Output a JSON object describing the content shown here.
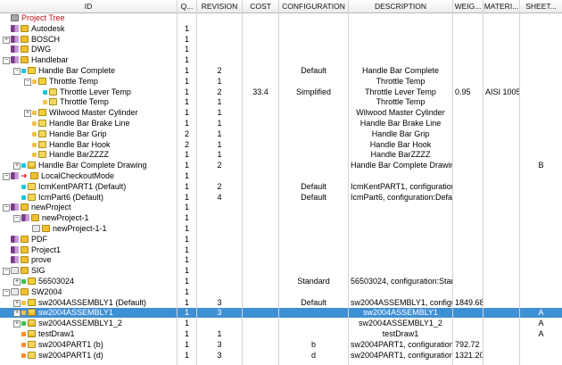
{
  "columns": {
    "id": "ID",
    "qty": "Q...",
    "revision": "REVISION",
    "cost": "COST",
    "configuration": "CONFIGURATION",
    "description": "DESCRIPTION",
    "weight": "WEIG...",
    "material": "MATERI...",
    "sheet": "SHEET..."
  },
  "colors": {
    "selection": "#3f8fd5",
    "root_text": "#c01010",
    "header_bg": "#ececec"
  },
  "rows": [
    {
      "label": "Project Tree",
      "depth": 0,
      "expander": "",
      "icons": [
        "root-icon"
      ],
      "qty": "",
      "revision": "",
      "cost": "",
      "configuration": "",
      "description": "",
      "weight": "",
      "material": "",
      "sheet": "",
      "root": true
    },
    {
      "label": "Autodesk",
      "depth": 0,
      "expander": "",
      "icons": [
        "stack-icon",
        "folder-icon"
      ],
      "qty": "1",
      "revision": "",
      "cost": "",
      "configuration": "",
      "description": "",
      "weight": "",
      "material": "",
      "sheet": ""
    },
    {
      "label": "BOSCH",
      "depth": 0,
      "expander": "+",
      "icons": [
        "stack-icon",
        "folder-icon"
      ],
      "qty": "1",
      "revision": "",
      "cost": "",
      "configuration": "",
      "description": "",
      "weight": "",
      "material": "",
      "sheet": ""
    },
    {
      "label": "DWG",
      "depth": 0,
      "expander": "",
      "icons": [
        "stack-icon",
        "folder-icon"
      ],
      "qty": "1",
      "revision": "",
      "cost": "",
      "configuration": "",
      "description": "",
      "weight": "",
      "material": "",
      "sheet": ""
    },
    {
      "label": "Handlebar",
      "depth": 0,
      "expander": "-",
      "icons": [
        "stack-icon",
        "folder-icon"
      ],
      "qty": "1",
      "revision": "",
      "cost": "",
      "configuration": "",
      "description": "",
      "weight": "",
      "material": "",
      "sheet": ""
    },
    {
      "label": "Handle Bar Complete",
      "depth": 1,
      "expander": "-",
      "icons": [
        "cyan-square-icon",
        "assembly-icon"
      ],
      "qty": "1",
      "revision": "2",
      "cost": "",
      "configuration": "Default",
      "description": "Handle Bar Complete",
      "weight": "",
      "material": "",
      "sheet": ""
    },
    {
      "label": "Throttle Temp",
      "depth": 2,
      "expander": "-",
      "icons": [
        "yellow-square-icon",
        "assembly-icon"
      ],
      "qty": "1",
      "revision": "1",
      "cost": "",
      "configuration": "",
      "description": "Throttle Temp",
      "weight": "",
      "material": "",
      "sheet": ""
    },
    {
      "label": "Throttle Lever Temp",
      "depth": 3,
      "expander": "",
      "icons": [
        "cyan-square-icon",
        "part-icon"
      ],
      "qty": "1",
      "revision": "2",
      "cost": "33.4",
      "configuration": "Simplified",
      "description": "Throttle Lever Temp",
      "weight": "0.95",
      "material": "AISI 1005...",
      "sheet": ""
    },
    {
      "label": "Throttle Temp",
      "depth": 3,
      "expander": "",
      "icons": [
        "yellow-square-icon",
        "part-icon"
      ],
      "qty": "1",
      "revision": "1",
      "cost": "",
      "configuration": "",
      "description": "Throttle Temp",
      "weight": "",
      "material": "",
      "sheet": ""
    },
    {
      "label": "Wilwood Master Cylinder",
      "depth": 2,
      "expander": "+",
      "icons": [
        "yellow-square-icon",
        "assembly-icon"
      ],
      "qty": "1",
      "revision": "1",
      "cost": "",
      "configuration": "",
      "description": "Wilwood Master Cylinder",
      "weight": "",
      "material": "",
      "sheet": ""
    },
    {
      "label": "Handle Bar Brake Line",
      "depth": 2,
      "expander": "",
      "icons": [
        "yellow-square-icon",
        "part-icon"
      ],
      "qty": "1",
      "revision": "1",
      "cost": "",
      "configuration": "",
      "description": "Handle Bar Brake Line",
      "weight": "",
      "material": "",
      "sheet": ""
    },
    {
      "label": "Handle Bar Grip",
      "depth": 2,
      "expander": "",
      "icons": [
        "yellow-square-icon",
        "part-icon"
      ],
      "qty": "2",
      "revision": "1",
      "cost": "",
      "configuration": "",
      "description": "Handle Bar Grip",
      "weight": "",
      "material": "",
      "sheet": ""
    },
    {
      "label": "Handle Bar Hook",
      "depth": 2,
      "expander": "",
      "icons": [
        "yellow-square-icon",
        "part-icon"
      ],
      "qty": "2",
      "revision": "1",
      "cost": "",
      "configuration": "",
      "description": "Handle Bar Hook",
      "weight": "",
      "material": "",
      "sheet": ""
    },
    {
      "label": "Handle BarZZZZ",
      "depth": 2,
      "expander": "",
      "icons": [
        "yellow-square-icon",
        "part-icon"
      ],
      "qty": "1",
      "revision": "1",
      "cost": "",
      "configuration": "",
      "description": "Handle BarZZZZ",
      "weight": "",
      "material": "",
      "sheet": ""
    },
    {
      "label": "Handle Bar Complete Drawing",
      "depth": 1,
      "expander": "+",
      "icons": [
        "cyan-square-icon",
        "drawing-icon"
      ],
      "qty": "1",
      "revision": "2",
      "cost": "",
      "configuration": "",
      "description": "Handle Bar Complete Drawing",
      "weight": "",
      "material": "",
      "sheet": "B"
    },
    {
      "label": "LocalCheckoutMode",
      "depth": 0,
      "expander": "-",
      "icons": [
        "stack-icon",
        "red-arrow-icon",
        "folder-icon"
      ],
      "qty": "1",
      "revision": "",
      "cost": "",
      "configuration": "",
      "description": "",
      "weight": "",
      "material": "",
      "sheet": ""
    },
    {
      "label": "IcmKentPART1 (Default)",
      "depth": 1,
      "expander": "",
      "icons": [
        "cyan-square-icon",
        "part-icon"
      ],
      "qty": "1",
      "revision": "2",
      "cost": "",
      "configuration": "Default",
      "description": "IcmKentPART1, configuration...",
      "weight": "",
      "material": "",
      "sheet": ""
    },
    {
      "label": "IcmPart6 (Default)",
      "depth": 1,
      "expander": "",
      "icons": [
        "cyan-square-icon",
        "part-icon"
      ],
      "qty": "1",
      "revision": "4",
      "cost": "",
      "configuration": "Default",
      "description": "IcmPart6, configuration:Default",
      "weight": "",
      "material": "",
      "sheet": ""
    },
    {
      "label": "newProject",
      "depth": 0,
      "expander": "-",
      "icons": [
        "stack-icon",
        "folder-icon"
      ],
      "qty": "1",
      "revision": "",
      "cost": "",
      "configuration": "",
      "description": "",
      "weight": "",
      "material": "",
      "sheet": ""
    },
    {
      "label": "newProject-1",
      "depth": 1,
      "expander": "-",
      "icons": [
        "stack-icon",
        "folder-icon"
      ],
      "qty": "1",
      "revision": "",
      "cost": "",
      "configuration": "",
      "description": "",
      "weight": "",
      "material": "",
      "sheet": ""
    },
    {
      "label": "newProject-1-1",
      "depth": 2,
      "expander": "",
      "icons": [
        "database-icon",
        "folder-icon"
      ],
      "qty": "1",
      "revision": "",
      "cost": "",
      "configuration": "",
      "description": "",
      "weight": "",
      "material": "",
      "sheet": ""
    },
    {
      "label": "PDF",
      "depth": 0,
      "expander": "",
      "icons": [
        "stack-icon",
        "folder-icon"
      ],
      "qty": "1",
      "revision": "",
      "cost": "",
      "configuration": "",
      "description": "",
      "weight": "",
      "material": "",
      "sheet": ""
    },
    {
      "label": "Project1",
      "depth": 0,
      "expander": "",
      "icons": [
        "stack-icon",
        "folder-icon"
      ],
      "qty": "1",
      "revision": "",
      "cost": "",
      "configuration": "",
      "description": "",
      "weight": "",
      "material": "",
      "sheet": ""
    },
    {
      "label": "prove",
      "depth": 0,
      "expander": "",
      "icons": [
        "stack-icon",
        "folder-icon"
      ],
      "qty": "1",
      "revision": "",
      "cost": "",
      "configuration": "",
      "description": "",
      "weight": "",
      "material": "",
      "sheet": ""
    },
    {
      "label": "SIG",
      "depth": 0,
      "expander": "-",
      "icons": [
        "database-icon",
        "folder-icon"
      ],
      "qty": "1",
      "revision": "",
      "cost": "",
      "configuration": "",
      "description": "",
      "weight": "",
      "material": "",
      "sheet": ""
    },
    {
      "label": "56503024",
      "depth": 1,
      "expander": "+",
      "icons": [
        "green-square-icon",
        "assembly-icon"
      ],
      "qty": "1",
      "revision": "",
      "cost": "",
      "configuration": "Standard",
      "description": "56503024, configuration:Stan...",
      "weight": "",
      "material": "",
      "sheet": ""
    },
    {
      "label": "SW2004",
      "depth": 0,
      "expander": "-",
      "icons": [
        "database-icon",
        "folder-icon"
      ],
      "qty": "1",
      "revision": "",
      "cost": "",
      "configuration": "",
      "description": "",
      "weight": "",
      "material": "",
      "sheet": ""
    },
    {
      "label": "sw2004ASSEMBLY1 (Default)",
      "depth": 1,
      "expander": "+",
      "icons": [
        "yellow-square-icon",
        "assembly-icon"
      ],
      "qty": "1",
      "revision": "3",
      "cost": "",
      "configuration": "Default",
      "description": "sw2004ASSEMBLY1, configu...",
      "weight": "1849.68",
      "material": "",
      "sheet": ""
    },
    {
      "label": "sw2004ASSEMBLY1",
      "depth": 1,
      "expander": "+",
      "icons": [
        "yellow-square-icon",
        "drawing-icon"
      ],
      "qty": "1",
      "revision": "3",
      "cost": "",
      "configuration": "",
      "description": "sw2004ASSEMBLY1",
      "weight": "",
      "material": "",
      "sheet": "A",
      "selected": true
    },
    {
      "label": "sw2004ASSEMBLY1_2",
      "depth": 1,
      "expander": "+",
      "icons": [
        "green-square-icon",
        "drawing-icon"
      ],
      "qty": "1",
      "revision": "",
      "cost": "",
      "configuration": "",
      "description": "sw2004ASSEMBLY1_2",
      "weight": "",
      "material": "",
      "sheet": "A"
    },
    {
      "label": "testDraw1",
      "depth": 1,
      "expander": "",
      "icons": [
        "orange-square-icon",
        "drawing-icon"
      ],
      "qty": "1",
      "revision": "1",
      "cost": "",
      "configuration": "",
      "description": "testDraw1",
      "weight": "",
      "material": "",
      "sheet": "A"
    },
    {
      "label": "sw2004PART1 (b)",
      "depth": 1,
      "expander": "",
      "icons": [
        "orange-square-icon",
        "part-icon"
      ],
      "qty": "1",
      "revision": "3",
      "cost": "",
      "configuration": "b",
      "description": "sw2004PART1, configuration:b",
      "weight": "792.72",
      "material": "",
      "sheet": ""
    },
    {
      "label": "sw2004PART1 (d)",
      "depth": 1,
      "expander": "",
      "icons": [
        "orange-square-icon",
        "part-icon"
      ],
      "qty": "1",
      "revision": "3",
      "cost": "",
      "configuration": "d",
      "description": "sw2004PART1, configuration:d",
      "weight": "1321.20",
      "material": "",
      "sheet": ""
    }
  ]
}
